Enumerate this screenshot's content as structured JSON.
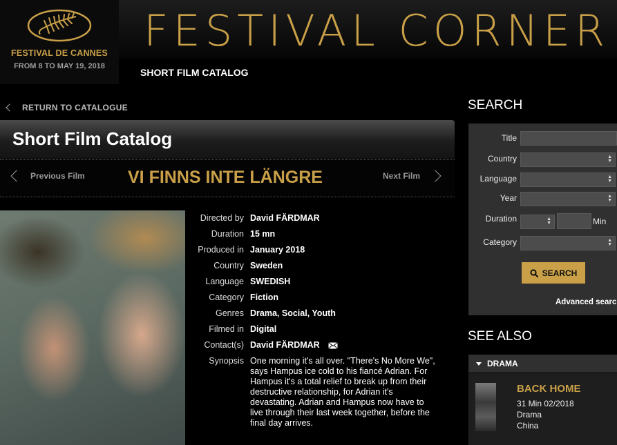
{
  "header": {
    "festival_name": "FESTIVAL DE CANNES",
    "festival_dates": "FROM 8 TO MAY 19, 2018",
    "banner_title": "FESTIVAL CORNER",
    "nav_catalog": "SHORT FILM CATALOG",
    "logo_icon": "palm-leaf-icon",
    "accent_color": "#c9a048"
  },
  "main": {
    "return_label": "RETURN TO CATALOGUE",
    "catalog_title": "Short Film Catalog",
    "prev_film": "Previous Film",
    "next_film": "Next Film",
    "film_title": "VI FINNS INTE LÄNGRE",
    "details": [
      {
        "label": "Directed by",
        "value": "David FÄRDMAR"
      },
      {
        "label": "Duration",
        "value": "15 mn"
      },
      {
        "label": "Produced in",
        "value": "January 2018"
      },
      {
        "label": "Country",
        "value": "Sweden"
      },
      {
        "label": "Language",
        "value": "SWEDISH"
      },
      {
        "label": "Category",
        "value": "Fiction"
      },
      {
        "label": "Genres",
        "value": "Drama, Social, Youth"
      },
      {
        "label": "Filmed in",
        "value": "Digital"
      },
      {
        "label": "Contact(s)",
        "value": "David FÄRDMAR"
      }
    ],
    "synopsis_label": "Synopsis",
    "synopsis": "One morning it's all over. \"There's No More We\", says Hampus ice cold to his fiancé Adrian. For Hampus it's a total relief to break up from their destructive relationship, for Adrian it's devastating. Adrian and Hampus now have to live through their last week together, before the final day arrives."
  },
  "sidebar": {
    "search_heading": "SEARCH",
    "fields": {
      "title": "Title",
      "country": "Country",
      "language": "Language",
      "year": "Year",
      "duration": "Duration",
      "min": "Min",
      "category": "Category"
    },
    "search_button": "SEARCH",
    "advanced_search": "Advanced search",
    "see_also_heading": "SEE ALSO",
    "drama_label": "DRAMA",
    "related": {
      "title": "BACK HOME",
      "duration_date": "31 Min 02/2018",
      "genre": "Drama",
      "country": "China"
    }
  }
}
